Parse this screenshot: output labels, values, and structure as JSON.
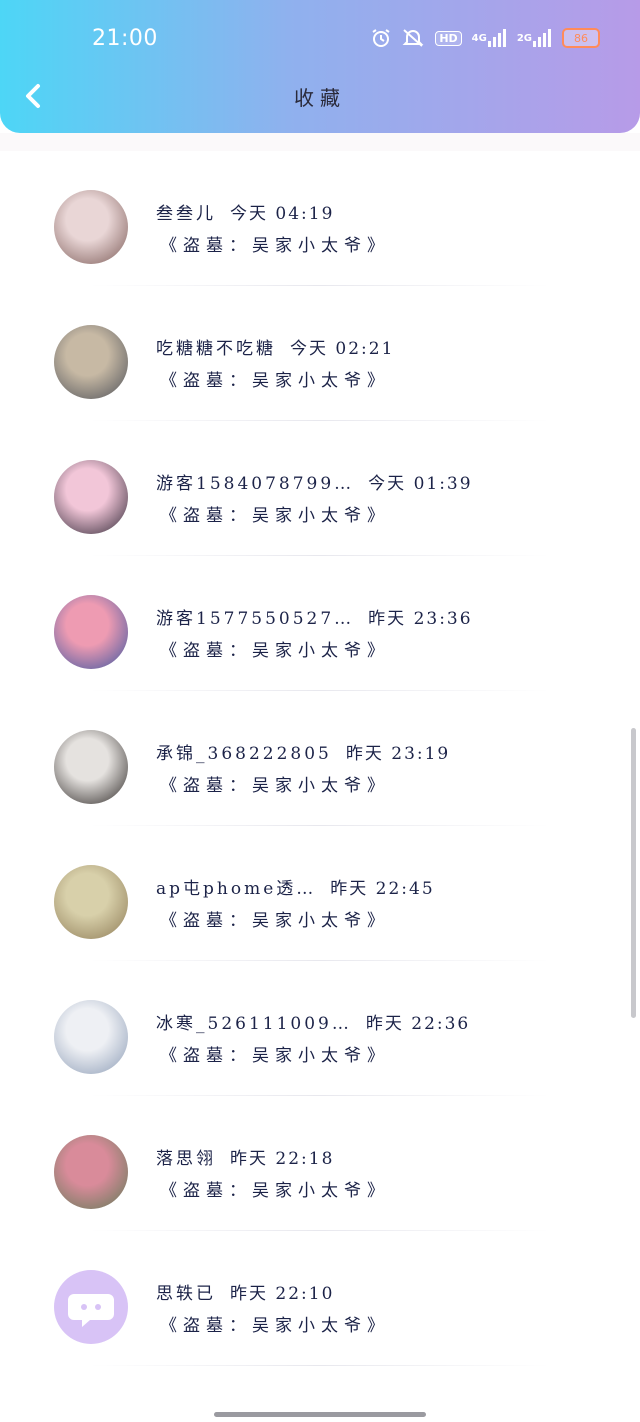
{
  "status_bar": {
    "time": "21:00",
    "hd": "HD",
    "net1": "4G",
    "net2": "2G",
    "battery": "86"
  },
  "header": {
    "title": "收藏"
  },
  "items": [
    {
      "name": "叁叁儿",
      "time": "今天 04:19",
      "book": "《盗墓：吴家小太爷》",
      "avatar_colors": [
        "#e9d6d6",
        "#7b5a56"
      ]
    },
    {
      "name": "吃糖糖不吃糖",
      "time": "今天 02:21",
      "book": "《盗墓：吴家小太爷》",
      "avatar_colors": [
        "#c7b9a4",
        "#4c4f57"
      ]
    },
    {
      "name": "游客1584078799…",
      "time": "今天 01:39",
      "book": "《盗墓：吴家小太爷》",
      "avatar_colors": [
        "#f2c6d8",
        "#2d2533"
      ]
    },
    {
      "name": "游客1577550527…",
      "time": "昨天 23:36",
      "book": "《盗墓：吴家小太爷》",
      "avatar_colors": [
        "#ee9bb2",
        "#3a54a0"
      ]
    },
    {
      "name": "承锦_368222805",
      "time": "昨天 23:19",
      "book": "《盗墓：吴家小太爷》",
      "avatar_colors": [
        "#e5e2df",
        "#2b2624"
      ]
    },
    {
      "name": "ap屯phome透…",
      "time": "昨天 22:45",
      "book": "《盗墓：吴家小太爷》",
      "avatar_colors": [
        "#d8d0aa",
        "#8d7a55"
      ]
    },
    {
      "name": "冰寒_526111009…",
      "time": "昨天 22:36",
      "book": "《盗墓：吴家小太爷》",
      "avatar_colors": [
        "#eef0f4",
        "#8b9bb5"
      ]
    },
    {
      "name": "落思翎",
      "time": "昨天 22:18",
      "book": "《盗墓：吴家小太爷》",
      "avatar_colors": [
        "#d98b9a",
        "#5f7a55"
      ]
    },
    {
      "name": "思轶已",
      "time": "昨天 22:10",
      "book": "《盗墓：吴家小太爷》",
      "avatar_colors": [
        "#d8c3f6",
        "#d8c3f6"
      ]
    }
  ]
}
